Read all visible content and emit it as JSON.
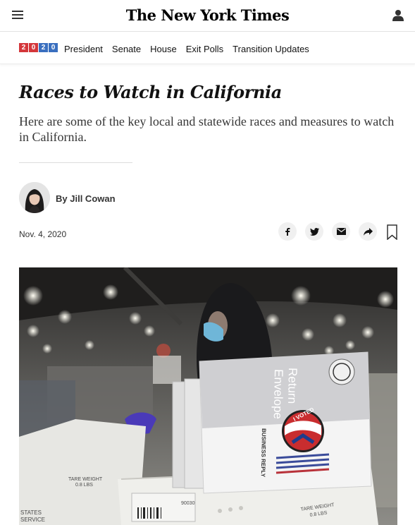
{
  "header": {
    "logo_text": "The New York Times",
    "menu_icon": "hamburger-menu-icon",
    "user_icon": "user-account-icon"
  },
  "nav": {
    "badge_digits": [
      "2",
      "0",
      "2",
      "0"
    ],
    "badge_colors": {
      "red": "#d4373b",
      "blue": "#3a6fbf"
    },
    "links": [
      "President",
      "Senate",
      "House",
      "Exit Polls",
      "Transition Updates"
    ]
  },
  "article": {
    "headline": "Races to Watch in California",
    "summary": "Here are some of the key local and statewide races and measures to watch in California.",
    "byline_prefix": "By",
    "author": "Jill Cowan",
    "date": "Nov. 4, 2020"
  },
  "share": {
    "icons": [
      "facebook-icon",
      "twitter-icon",
      "email-icon",
      "share-arrow-icon",
      "bookmark-icon"
    ]
  },
  "photo": {
    "envelope_title_1": "Return",
    "envelope_title_2": "Envelope",
    "sticker_text": "I VOTED",
    "business_reply_text": "BUSINESS REPLY",
    "tare_weight_1": "TARE WEIGHT",
    "tare_weight_1_value": "0.8 LBS",
    "tare_weight_2": "TARE WEIGHT",
    "tare_weight_2_value": "0.8 LBS",
    "tray_label": "STATES",
    "tray_label_2": "SERVICE",
    "barcode_number": "90030"
  }
}
